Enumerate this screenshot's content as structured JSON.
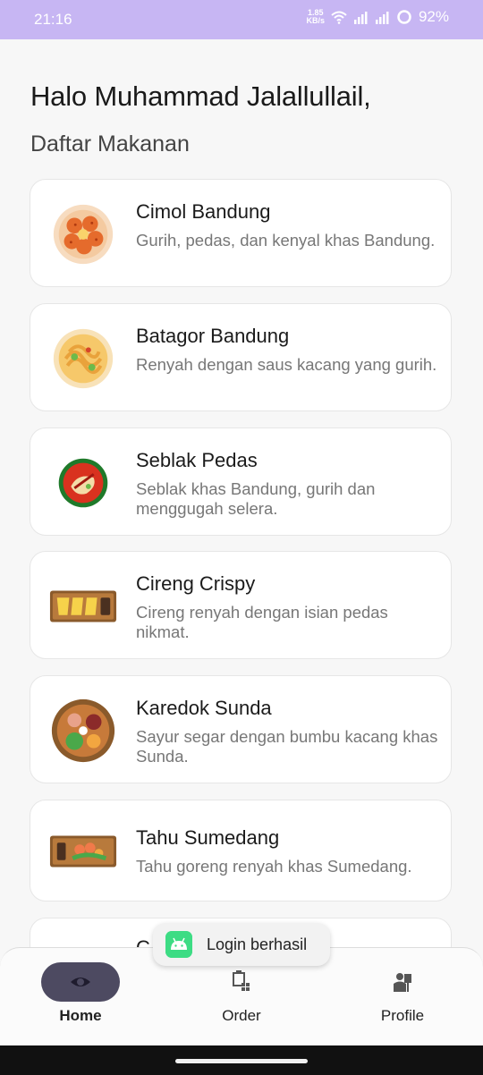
{
  "status_bar": {
    "time": "21:16",
    "net_speed_value": "1.85",
    "net_speed_unit": "KB/s",
    "battery": "92%",
    "icons": [
      "wifi-icon",
      "signal-icon",
      "signal-icon",
      "battery-ring-icon"
    ]
  },
  "header": {
    "greeting": "Halo Muhammad Jalallullail,",
    "section_title": "Daftar Makanan"
  },
  "foods": [
    {
      "name": "Cimol Bandung",
      "desc": "Gurih, pedas, dan kenyal khas Bandung.",
      "icon": "cimol-icon"
    },
    {
      "name": "Batagor Bandung",
      "desc": "Renyah dengan saus kacang yang gurih.",
      "icon": "batagor-icon"
    },
    {
      "name": "Seblak Pedas",
      "desc": "Seblak khas Bandung, gurih dan menggugah selera.",
      "icon": "seblak-icon"
    },
    {
      "name": "Cireng Crispy",
      "desc": "Cireng renyah dengan isian pedas nikmat.",
      "icon": "cireng-icon"
    },
    {
      "name": "Karedok Sunda",
      "desc": "Sayur segar dengan bumbu kacang khas Sunda.",
      "icon": "karedok-icon"
    },
    {
      "name": "Tahu Sumedang",
      "desc": "Tahu goreng renyah khas Sumedang.",
      "icon": "tahu-icon"
    },
    {
      "name": "C",
      "desc": "",
      "icon": "partial-food-icon"
    }
  ],
  "toast": {
    "text": "Login berhasil",
    "icon": "android-icon"
  },
  "nav": {
    "home": "Home",
    "order": "Order",
    "profile": "Profile",
    "icons": [
      "eye-icon",
      "order-icon",
      "profile-icon"
    ]
  },
  "colors": {
    "status_bar": "#c7b6f3",
    "nav_active_pill": "#4d4a61",
    "toast_icon": "#3ddc84"
  }
}
